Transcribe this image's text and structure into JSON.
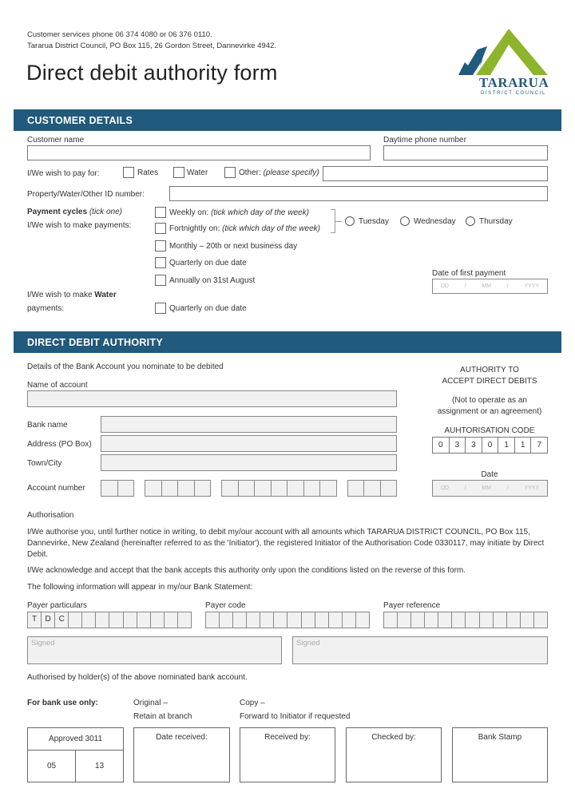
{
  "header": {
    "contact_line1": "Customer services phone 06 374 4080 or 06 376 0110.",
    "contact_line2": "Tararua District Council, PO Box 115, 26 Gordon Street, Dannevirke 4942.",
    "title": "Direct debit authority form",
    "logo": {
      "name": "TARARUA",
      "subtitle": "DISTRICT COUNCIL",
      "colors": {
        "blue": "#215a7c",
        "green": "#8db52b"
      }
    }
  },
  "customer_details": {
    "section_title": "CUSTOMER DETAILS",
    "customer_name_label": "Customer name",
    "customer_name_value": "",
    "daytime_phone_label": "Daytime phone number",
    "daytime_phone_value": "",
    "pay_for_label": "I/We wish to pay for:",
    "pay_for_options": [
      {
        "label": "Rates",
        "checked": false
      },
      {
        "label": "Water",
        "checked": false
      },
      {
        "label": "Other:",
        "label_italic": "(please specify)",
        "checked": false
      }
    ],
    "other_specify_value": "",
    "id_number_label": "Property/Water/Other ID number:",
    "id_number_value": "",
    "payment_cycles_label": "Payment cycles",
    "payment_cycles_hint": "(tick one)",
    "make_payments_label": "I/We wish to make payments:",
    "cycles": [
      {
        "label": "Weekly on:",
        "hint": "(tick which day of the week)",
        "checked": false
      },
      {
        "label": "Fortnightly on:",
        "hint": "(tick which day of the week)",
        "checked": false
      },
      {
        "label": "Monthly – 20th or next business day",
        "hint": "",
        "checked": false
      },
      {
        "label": "Quarterly on due date",
        "hint": "",
        "checked": false
      },
      {
        "label": "Annually on 31st August",
        "hint": "",
        "checked": false
      }
    ],
    "days": [
      {
        "label": "Tuesday",
        "selected": false
      },
      {
        "label": "Wednesday",
        "selected": false
      },
      {
        "label": "Thursday",
        "selected": false
      }
    ],
    "first_payment_label": "Date of first payment",
    "date_placeholder": {
      "dd": "DD",
      "mm": "MM",
      "yyyy": "YYYY",
      "sep": "/"
    },
    "water_label_prefix": "I/We wish to make",
    "water_label_bold": "Water",
    "water_label_suffix": "payments:",
    "water_option": {
      "label": "Quarterly on due date",
      "checked": false
    }
  },
  "direct_debit": {
    "section_title": "DIRECT DEBIT AUTHORITY",
    "intro": "Details of the Bank Account you nominate to be debited",
    "account_name_label": "Name of account",
    "bank_name_label": "Bank name",
    "address_label": "Address (PO Box)",
    "town_label": "Town/City",
    "account_number_label": "Account number",
    "account_number_groups": [
      2,
      4,
      7,
      3
    ],
    "authority_line1": "AUTHORITY TO",
    "authority_line2": "ACCEPT DIRECT DEBITS",
    "not_operate_line1": "(Not to operate as an",
    "not_operate_line2": "assignment or an agreement)",
    "auth_code_label": "AUHTORISATION CODE",
    "auth_code": [
      "0",
      "3",
      "3",
      "0",
      "1",
      "1",
      "7"
    ],
    "date_label": "Date",
    "authorisation_heading": "Authorisation",
    "authorisation_text": "I/We authorise you, until further notice in writing, to debit my/our account with all amounts which TARARUA DISTRICT COUNCIL, PO Box 115, Dannevirke, New Zealand (hereinafter referred to as the 'Initiator'), the registered Initiator of the Authorisation Code 0330117, may initiate by Direct Debit.",
    "acknowledge_text": "I/We acknowledge and accept that the bank accepts this authority only upon the conditions listed on the reverse of this form.",
    "statement_text": "The following information will appear in my/our Bank Statement:",
    "payer_particulars_label": "Payer particulars",
    "payer_particulars": [
      "T",
      "D",
      "C",
      "",
      "",
      "",
      "",
      "",
      "",
      "",
      "",
      ""
    ],
    "payer_code_label": "Payer code",
    "payer_code": [
      "",
      "",
      "",
      "",
      "",
      "",
      "",
      "",
      "",
      "",
      "",
      ""
    ],
    "payer_reference_label": "Payer reference",
    "payer_reference": [
      "",
      "",
      "",
      "",
      "",
      "",
      "",
      "",
      "",
      "",
      "",
      ""
    ],
    "signed_placeholder": "Signed",
    "authorised_by": "Authorised by holder(s) of the above nominated bank account."
  },
  "bank_use": {
    "label": "For bank use only:",
    "original_line1": "Original –",
    "original_line2": "Retain at branch",
    "copy_line1": "Copy –",
    "copy_line2": "Forward to Initiator if requested",
    "approved_label": "Approved 3011",
    "approved_left": "05",
    "approved_right": "13",
    "boxes": [
      "Date received:",
      "Received by:",
      "Checked by:",
      "Bank Stamp"
    ]
  }
}
